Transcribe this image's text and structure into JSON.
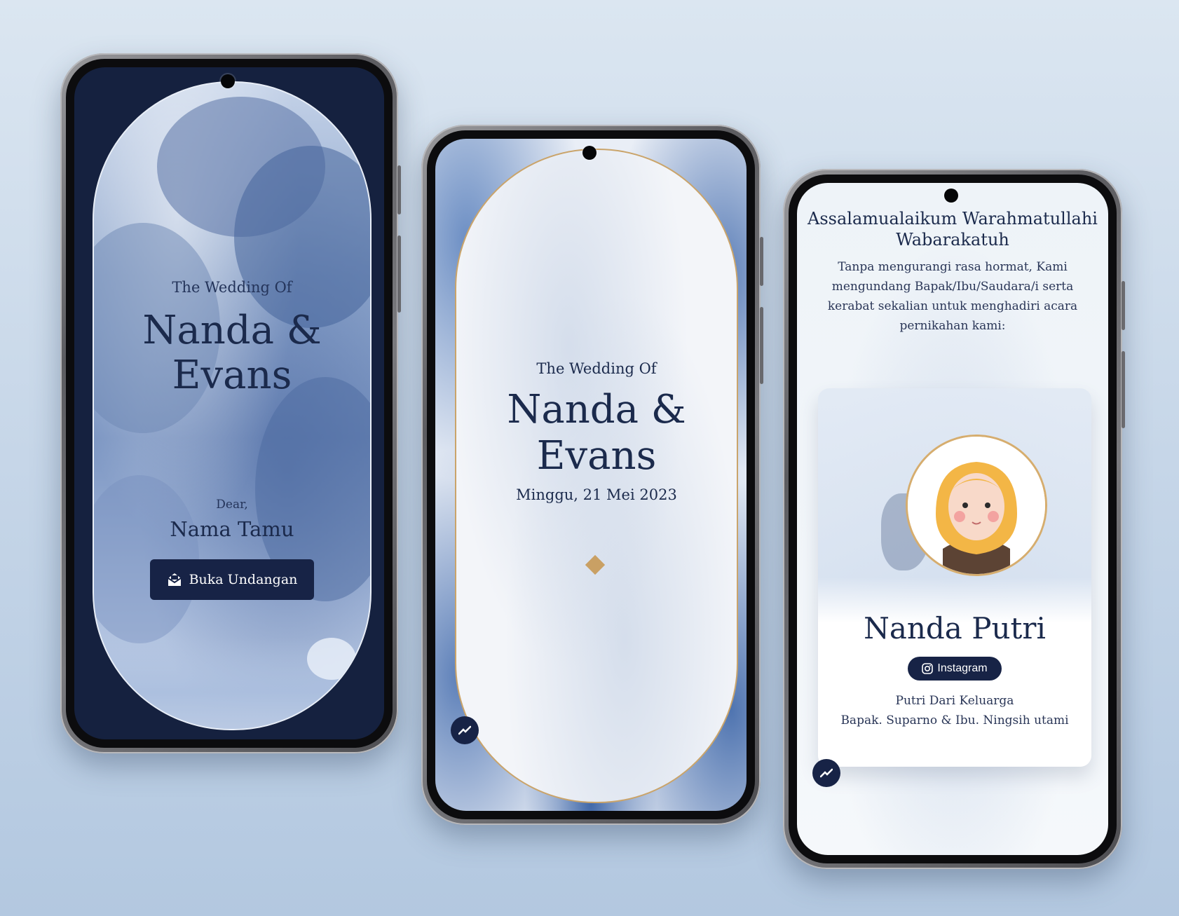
{
  "phone1": {
    "heading": "The Wedding Of",
    "couple_line1": "Nanda &",
    "couple_line2": "Evans",
    "dear_label": "Dear,",
    "guest_name": "Nama Tamu",
    "open_button_label": "Buka Undangan",
    "open_button_icon": "envelope-open-icon"
  },
  "phone2": {
    "heading": "The Wedding Of",
    "couple_line1": "Nanda &",
    "couple_line2": "Evans",
    "date": "Minggu, 21 Mei 2023",
    "scroll_icon": "auto-scroll-icon"
  },
  "phone3": {
    "greeting_line1": "Assalamualaikum Warahmatullahi",
    "greeting_line2": "Wabarakatuh",
    "intro_line1": "Tanpa mengurangi rasa hormat, Kami",
    "intro_line2": "mengundang Bapak/Ibu/Saudara/i serta",
    "intro_line3": "kerabat sekalian untuk menghadiri acara",
    "intro_line4": "pernikahan kami:",
    "bride_name": "Nanda Putri",
    "instagram_label": "Instagram",
    "family_line1": "Putri Dari Keluarga",
    "family_line2": "Bapak. Suparno & Ibu. Ningsih utami",
    "scroll_icon": "auto-scroll-icon"
  },
  "colors": {
    "navy": "#172346",
    "gold": "#caa46a",
    "background": "#c6d6e8"
  }
}
